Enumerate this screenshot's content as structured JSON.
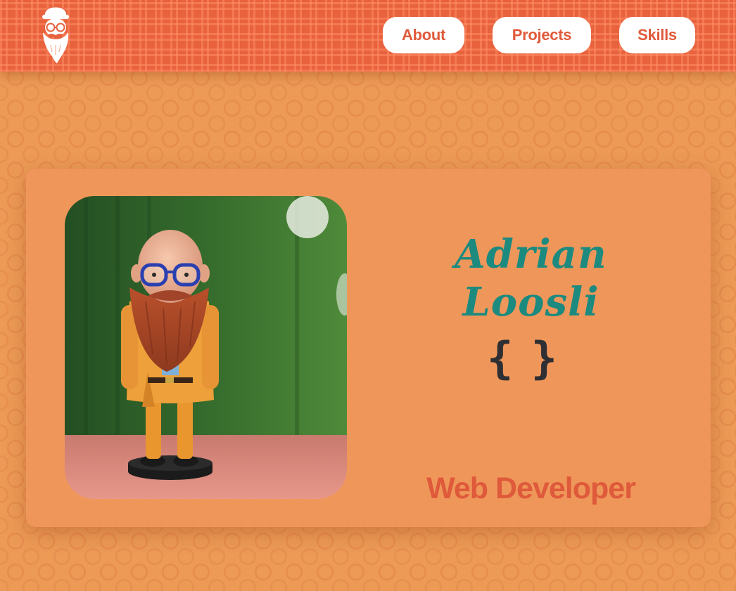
{
  "nav": {
    "items": [
      {
        "label": "About"
      },
      {
        "label": "Projects"
      },
      {
        "label": "Skills"
      }
    ]
  },
  "logo": {
    "icon": "bearded-man-logo-icon"
  },
  "hero": {
    "name_first": "Adrian",
    "name_last": "Loosli",
    "symbol": "{ }",
    "role": "Web Developer",
    "photo_alt": "Figurine of a bald bearded man with glasses"
  },
  "colors": {
    "header": "#e7623d",
    "background": "#ec9a56",
    "accent": "#df5a3a",
    "name": "#1c8a7f",
    "button": "#ffffff"
  }
}
